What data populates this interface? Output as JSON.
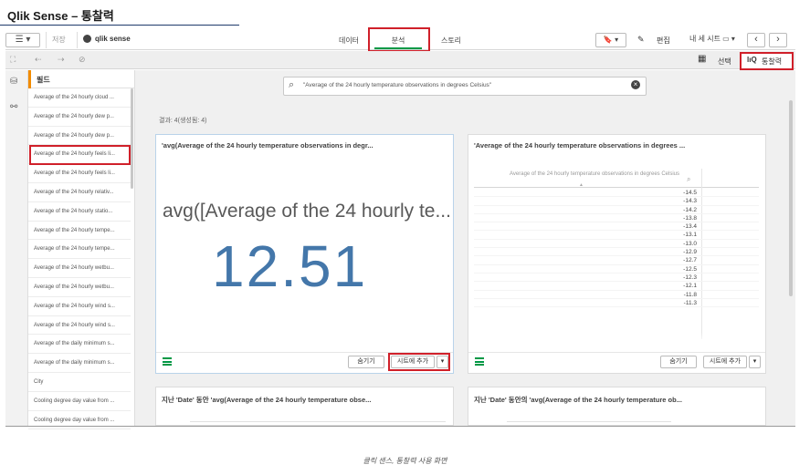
{
  "doc_title": "Qlik Sense – 통찰력",
  "toolbar": {
    "menu_icon": "☰ ▾",
    "save_label": "저장",
    "app_name": "qlik sense",
    "tabs": [
      {
        "label": "데이터"
      },
      {
        "label": "분석"
      },
      {
        "label": "스토리"
      }
    ],
    "bookmark_btn": "🔖 ▾",
    "edit_label": "편집",
    "sheet_menu": "내 세 시트 ▭ ▾",
    "prev": "‹",
    "next": "›"
  },
  "toolbar2": {
    "select_label": "선택",
    "insight_label": "통찰력"
  },
  "fields": {
    "title": "필드",
    "items": [
      "Average of the 24 hourly cloud ...",
      "Average of the 24 hourly dew p...",
      "Average of the 24 hourly dew p...",
      "Average of the 24 hourly feels li...",
      "Average of the 24 hourly feels li...",
      "Average of the 24 hourly relativ...",
      "Average of the 24 hourly statio...",
      "Average of the 24 hourly tempe...",
      "Average of the 24 hourly tempe...",
      "Average of the 24 hourly wetbu...",
      "Average of the 24 hourly wetbu...",
      "Average of the 24 hourly wind s...",
      "Average of the 24 hourly wind s...",
      "Average of the daily minimum s...",
      "Average of the daily minimum s...",
      "City",
      "Cooling degree day value from ...",
      "Cooling degree day value from ..."
    ]
  },
  "search": {
    "value": "\"Average of the 24 hourly temperature observations in degrees Celsius\""
  },
  "result_count": "결과: 4(생성됨: 4)",
  "cards": {
    "kpi": {
      "title": "'avg(Average of the 24 hourly temperature observations in degr...",
      "label": "avg([Average of the 24 hourly te...",
      "value": "12.51",
      "hide_btn": "숨기기",
      "add_btn": "시트에 추가",
      "dropdown": "▾"
    },
    "table": {
      "title": "'Average of the 24 hourly temperature observations in degrees ...",
      "column_header": "Average of the 24 hourly temperature observations in degrees Celsius",
      "rows": [
        "-14.5",
        "-14.3",
        "-14.2",
        "-13.8",
        "-13.4",
        "-13.1",
        "-13.0",
        "-12.9",
        "-12.7",
        "-12.5",
        "-12.3",
        "-12.1",
        "-11.8",
        "-11.3"
      ],
      "hide_btn": "숨기기",
      "add_btn": "시트에 추가",
      "dropdown": "▾"
    },
    "line1": {
      "title": "지난 'Date' 동안 'avg(Average of the 24 hourly temperature obse..."
    },
    "line2": {
      "title": "지난 'Date' 동안의 'avg(Average of the 24 hourly temperature ob..."
    }
  },
  "caption": "클릭 센스, 통찰력 사용 화면"
}
